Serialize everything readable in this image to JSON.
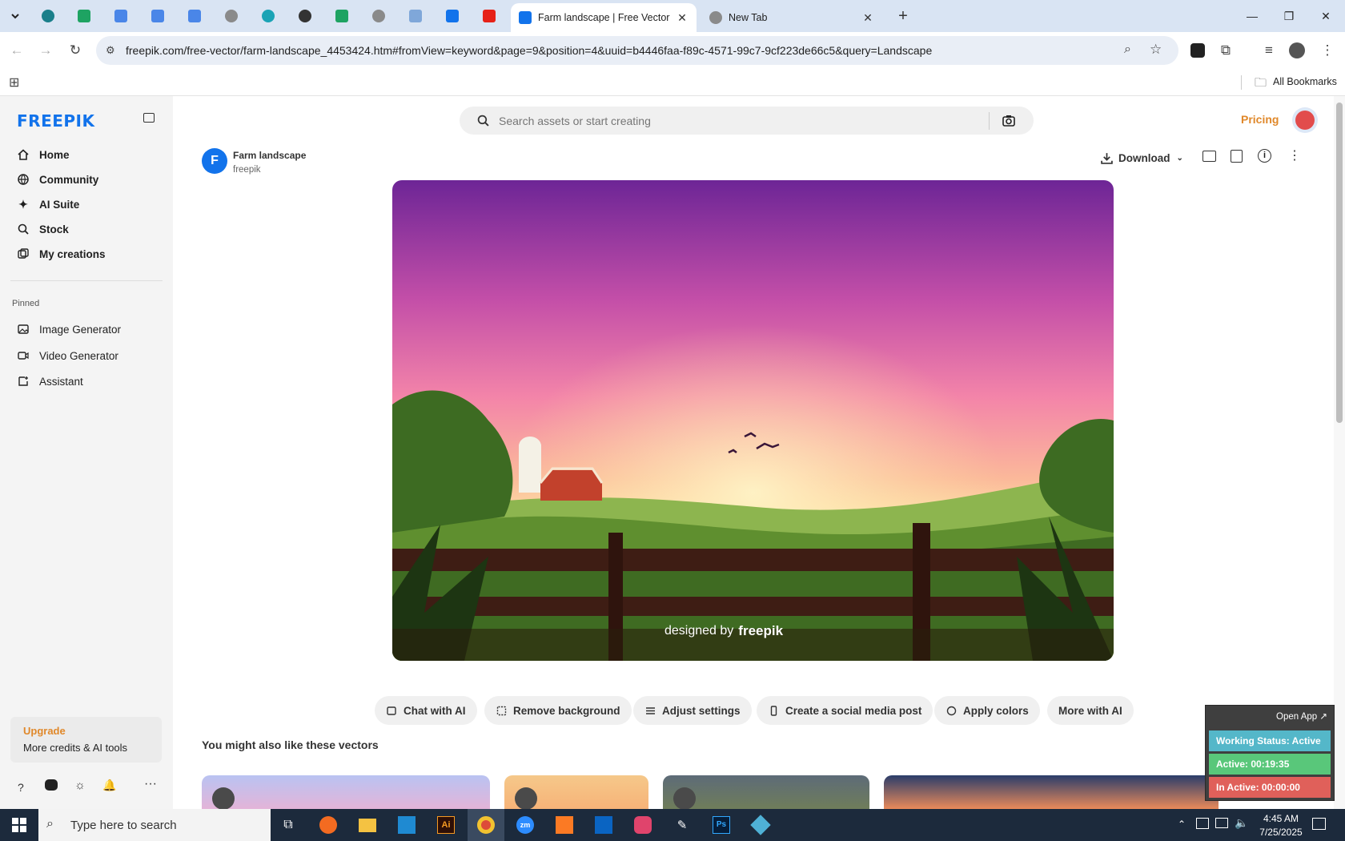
{
  "browser": {
    "tabs": [
      {
        "title": "Farm landscape | Free Vector",
        "active": true
      },
      {
        "title": "New Tab",
        "active": false
      }
    ],
    "url": "freepik.com/free-vector/farm-landscape_4453424.htm#fromView=keyword&page=9&position=4&uuid=b4446faa-f89c-4571-99c7-9cf223de66c5&query=Landscape",
    "all_bookmarks": "All Bookmarks"
  },
  "sidebar": {
    "logo": "FREEPIK",
    "nav": [
      "Home",
      "Community",
      "AI Suite",
      "Stock",
      "My creations"
    ],
    "pinned_heading": "Pinned",
    "pinned": [
      "Image Generator",
      "Video Generator",
      "Assistant"
    ],
    "upgrade_title": "Upgrade",
    "upgrade_sub": "More credits & AI tools"
  },
  "header": {
    "search_placeholder": "Search assets or start creating",
    "pricing": "Pricing"
  },
  "asset": {
    "title": "Farm landscape",
    "author": "freepik",
    "author_initial": "F",
    "download": "Download",
    "watermark_prefix": "designed by",
    "watermark_brand": "freepik"
  },
  "actions": [
    "Chat with AI",
    "Remove background",
    "Adjust settings",
    "Create a social media post",
    "Apply colors",
    "More with AI"
  ],
  "related_heading": "You might also like these vectors",
  "widget": {
    "open_app": "Open App ↗",
    "working_status": "Working Status: Active",
    "active": "Active: 00:19:35",
    "inactive": "In Active: 00:00:00"
  },
  "taskbar": {
    "search_placeholder": "Type here to search",
    "time": "4:45 AM",
    "date": "7/25/2025"
  },
  "colors": {
    "brand": "#1273eb",
    "pricing": "#e0882a",
    "upgrade": "#e0882a",
    "widget_status": "#54b7c9",
    "widget_active": "#59c77a",
    "widget_inactive": "#e0605a"
  }
}
